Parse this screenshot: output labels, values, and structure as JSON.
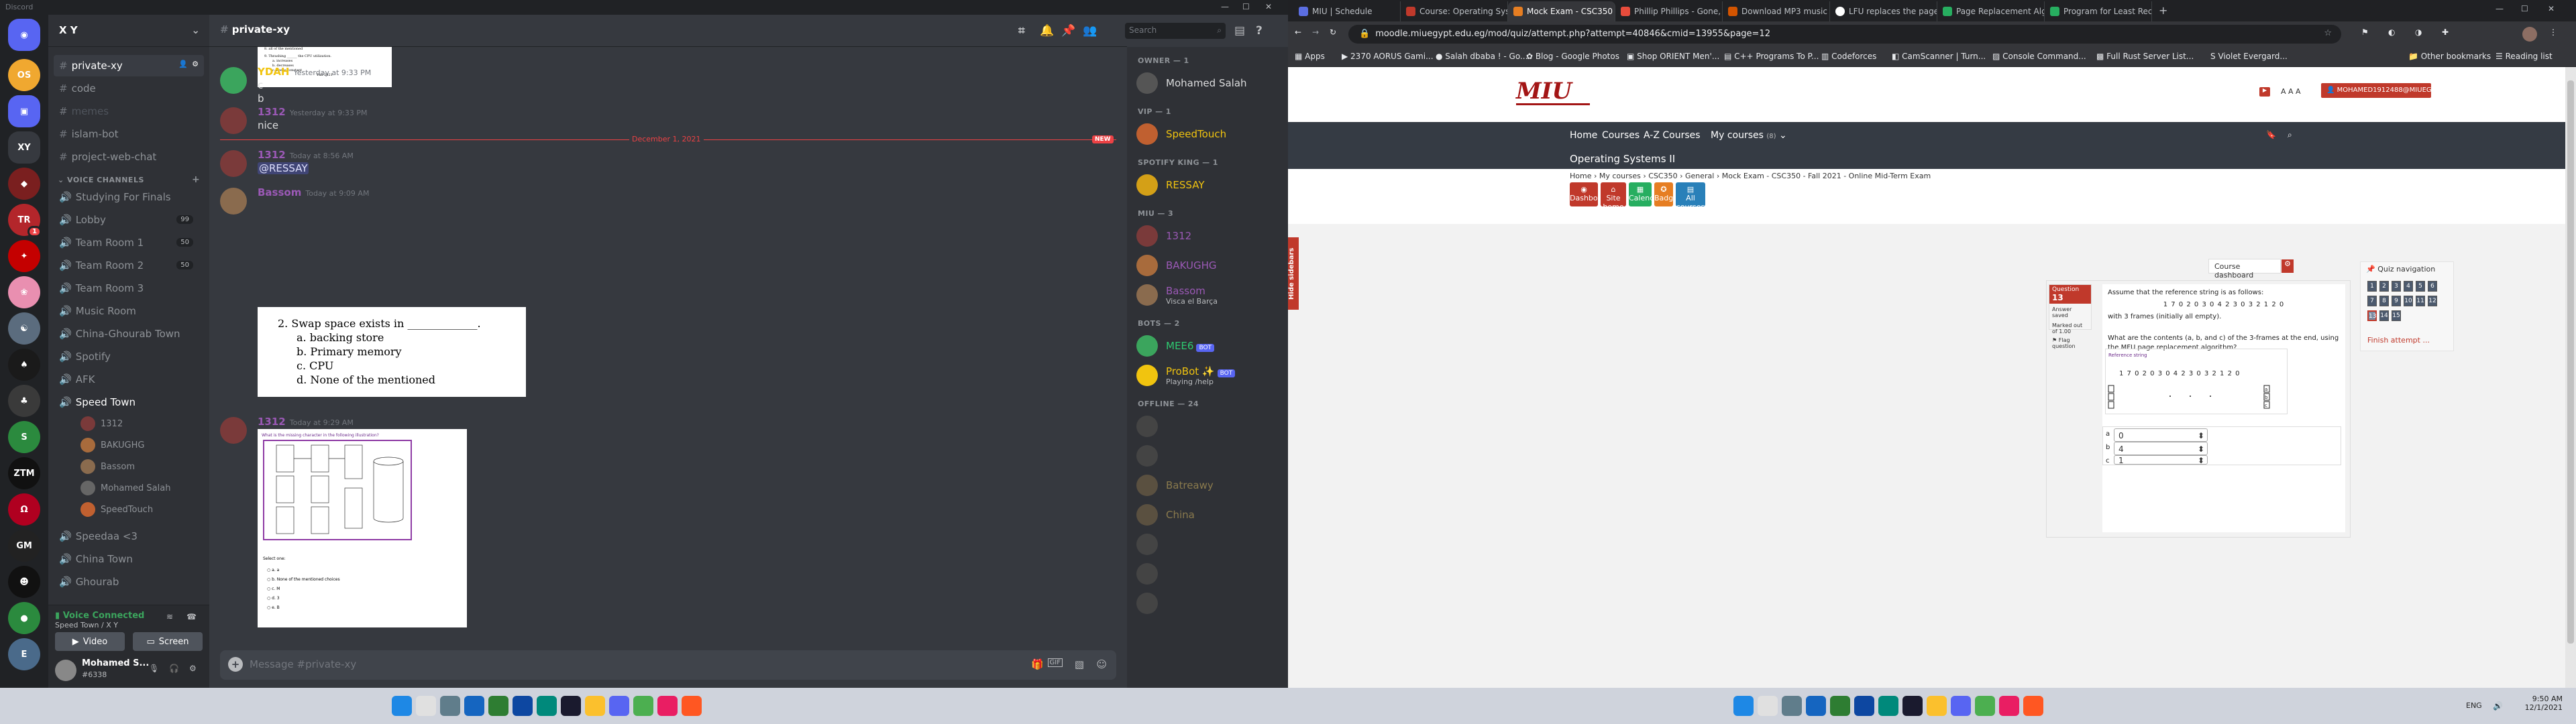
{
  "discord": {
    "app_title": "Discord",
    "server_name": "X Y",
    "channel_name": "private-xy",
    "text_channels": [
      "private-xy",
      "code",
      "memes",
      "islam-bot",
      "project-web-chat"
    ],
    "voice_category": "VOICE CHANNELS",
    "voice_channels": [
      {
        "name": "Studying For Finals",
        "count": ""
      },
      {
        "name": "Lobby",
        "count": "99"
      },
      {
        "name": "Team Room 1",
        "count": "50"
      },
      {
        "name": "Team Room 2",
        "count": "50"
      },
      {
        "name": "Team Room 3",
        "count": ""
      },
      {
        "name": "Music Room",
        "count": ""
      },
      {
        "name": "China-Ghourab Town",
        "count": ""
      },
      {
        "name": "Spotify",
        "count": ""
      },
      {
        "name": "AFK",
        "count": ""
      },
      {
        "name": "Speed Town",
        "count": ""
      }
    ],
    "voice_users": [
      "1312",
      "BAKUGHG",
      "Bassom",
      "Mohamed Salah",
      "SpeedTouch"
    ],
    "more_channels": [
      "Speedaa <3",
      "China Town",
      "Ghourab"
    ],
    "voice_status": "Voice Connected",
    "voice_location": "Speed Town / X Y",
    "video_label": "Video",
    "screen_label": "Screen",
    "username": "Mohamed S...",
    "user_tag": "#6338",
    "search_placeholder": "Search",
    "divider_label": "December 1, 2021",
    "new_label": "NEW",
    "input_placeholder": "Message #private-xy",
    "messages": [
      {
        "author": "YDAH",
        "time": "Yesterday at 9:33 PM",
        "lines": [
          "c",
          "b"
        ],
        "color": "#f1c40f"
      },
      {
        "author": "1312",
        "time": "Yesterday at 9:33 PM",
        "lines": [
          "nice"
        ],
        "color": "#9b59b6"
      },
      {
        "author": "1312",
        "time": "Today at 8:56 AM",
        "lines": [
          "@RESSAY"
        ],
        "color": "#9b59b6"
      },
      {
        "author": "Bassom",
        "time": "Today at 9:09 AM",
        "lines": [],
        "color": "#9b59b6"
      },
      {
        "author": "1312",
        "time": "Today at 9:29 AM",
        "lines": [],
        "color": "#9b59b6"
      }
    ],
    "attachment1": {
      "top_lines": [
        "8. all of the mentioned",
        "9. Thrashing ______ the CPU utilization.",
        "a. increases",
        "b. decreases",
        "c. keeps constant",
        "Fall 2021"
      ]
    },
    "attachment2": {
      "q": "2.  Swap space exists in _____________.",
      "opts": [
        "a.  backing store",
        "b.  Primary memory",
        "c.  CPU",
        "d.  None of the mentioned"
      ]
    },
    "attachment3": {
      "title": "What is the missing character in the following illustration?",
      "opts": [
        "a. a",
        "b. None of the mentioned choices",
        "c. M",
        "d. 3",
        "e. B"
      ],
      "select": "Select one:"
    },
    "member_groups": [
      {
        "title": "OWNER — 1",
        "members": [
          {
            "name": "Mohamed Salah",
            "sub": "",
            "color": "#dcddde"
          }
        ]
      },
      {
        "title": "VIP — 1",
        "members": [
          {
            "name": "SpeedTouch",
            "sub": "",
            "color": "#f1c40f"
          }
        ]
      },
      {
        "title": "SPOTIFY KING — 1",
        "members": [
          {
            "name": "RESSAY",
            "sub": "",
            "color": "#f1c40f"
          }
        ]
      },
      {
        "title": "MIU — 3",
        "members": [
          {
            "name": "1312",
            "sub": "",
            "color": "#9b59b6"
          },
          {
            "name": "BAKUGHG",
            "sub": "",
            "color": "#9b59b6"
          },
          {
            "name": "Bassom",
            "sub": "Visca el Barça",
            "color": "#9b59b6"
          }
        ]
      },
      {
        "title": "BOTS — 2",
        "members": [
          {
            "name": "MEE6",
            "sub": "",
            "color": "#2ecc71",
            "bot": "BOT"
          },
          {
            "name": "ProBot ✨",
            "sub": "Playing /help",
            "color": "#f1c40f",
            "bot": "BOT"
          }
        ]
      },
      {
        "title": "OFFLINE — 24",
        "members": [
          {
            "name": "",
            "sub": "",
            "color": "#5c5e62"
          },
          {
            "name": "",
            "sub": "",
            "color": "#5c5e62"
          },
          {
            "name": "Batreawy",
            "sub": "",
            "color": "#8a7a4d"
          },
          {
            "name": "China",
            "sub": "",
            "color": "#8a7a4d"
          },
          {
            "name": "",
            "sub": "",
            "color": "#5c5e62"
          },
          {
            "name": "",
            "sub": "",
            "color": "#5c5e62"
          },
          {
            "name": "",
            "sub": "",
            "color": "#5c5e62"
          }
        ]
      }
    ]
  },
  "browser": {
    "tabs": [
      "MIU | Schedule",
      "Course: Operating System...",
      "Mock Exam - CSC350 - Fall...",
      "Phillip Phillips - Gone, Gon...",
      "Download MP3 music fro...",
      "LFU replaces the page th...",
      "Page Replacement Algorit...",
      "Program for Least Recen..."
    ],
    "active_tab": 2,
    "url": "moodle.miuegypt.edu.eg/mod/quiz/attempt.php?attempt=40846&cmid=13955&page=12",
    "bookmarks": [
      "Apps",
      "2370 AORUS Gami...",
      "Salah dbaba ! - Go...",
      "Blog - Google Photos",
      "Shop ORIENT Men'...",
      "C++ Programs To P...",
      "Codeforces",
      "CamScanner | Turn...",
      "Console Command...",
      "Full Rust Server List...",
      "Violet Evergard...",
      "Other bookmarks",
      "Reading list"
    ]
  },
  "moodle": {
    "logo": "MIU",
    "font_sizes": "A A A",
    "user_email": "MOHAMED1912488@MIUEGYPT.EDU.EG",
    "nav": [
      "Home",
      "Courses",
      "A-Z Courses",
      "My courses"
    ],
    "my_courses_count": "(8)",
    "course_title": "Operating Systems II",
    "breadcrumb": "Home › My courses › CSC350 › General › Mock Exam - CSC350 - Fall 2021 - Online Mid-Term Exam",
    "buttons": [
      {
        "label": "Dashboard",
        "color": "#c0392b"
      },
      {
        "label": "Site home",
        "color": "#c0392b"
      },
      {
        "label": "Calendar",
        "color": "#27ae60"
      },
      {
        "label": "Badges",
        "color": "#e67e22"
      },
      {
        "label": "All courses",
        "color": "#2980b9"
      }
    ],
    "hide_sidebars": "Hide sidebars",
    "course_dashboard": "Course dashboard",
    "question": {
      "label": "Question",
      "number": "13",
      "status": "Answer saved",
      "marks": "Marked out of 1.00",
      "flag": "Flag question"
    },
    "q_text1": "Assume that the reference string is as follows:",
    "ref_string": "1 7 0 2 0 3 0 4 2 3 0 3 2 1 2 0",
    "q_text2": "with 3 frames (initially all empty).",
    "q_text3": "What are the contents (a, b, and c) of the 3-frames at the end, using the MFU page replacement algorithm?",
    "diagram_label": "Reference string",
    "diagram_string": "1  7  0  2  0  3  0  4  2  3  0  3  2  1  2  0",
    "frame_labels": [
      "a",
      "b",
      "c"
    ],
    "answers": [
      {
        "label": "a",
        "value": "0"
      },
      {
        "label": "b",
        "value": "4"
      },
      {
        "label": "c",
        "value": "1"
      }
    ],
    "quiz_nav_title": "Quiz navigation",
    "quiz_nav_numbers": [
      "1",
      "2",
      "3",
      "4",
      "5",
      "6",
      "7",
      "8",
      "9",
      "10",
      "11",
      "12",
      "13",
      "14",
      "15"
    ],
    "current_q": "13",
    "finish_attempt": "Finish attempt ..."
  },
  "taskbar": {
    "lang": "ENG",
    "time": "9:50 AM",
    "date": "12/1/2021"
  }
}
